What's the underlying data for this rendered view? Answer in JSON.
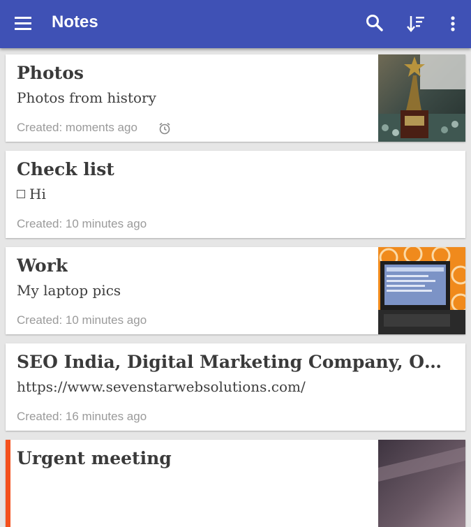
{
  "appbar": {
    "title": "Notes",
    "menu_icon": "menu-icon",
    "search_icon": "search-icon",
    "sort_icon": "sort-icon",
    "more_icon": "more-vert-icon",
    "color": "#3f51b5"
  },
  "notes": [
    {
      "title": "Photos",
      "body": "Photos from history",
      "created": "Created: moments ago",
      "has_alarm": true,
      "thumbnail": "trophy-photo"
    },
    {
      "title": "Check list",
      "checklist_item": "Hi",
      "created": "Created: 10 minutes ago"
    },
    {
      "title": "Work",
      "body": "My laptop pics",
      "created": "Created: 10 minutes ago",
      "thumbnail": "laptop-photo"
    },
    {
      "title": "SEO India, Digital Marketing Company, Online...",
      "body": "https://www.sevenstarwebsolutions.com/",
      "created": "Created: 16 minutes ago"
    },
    {
      "title": "Urgent meeting",
      "accent_color": "#f4511e",
      "thumbnail": "meeting-photo"
    }
  ]
}
